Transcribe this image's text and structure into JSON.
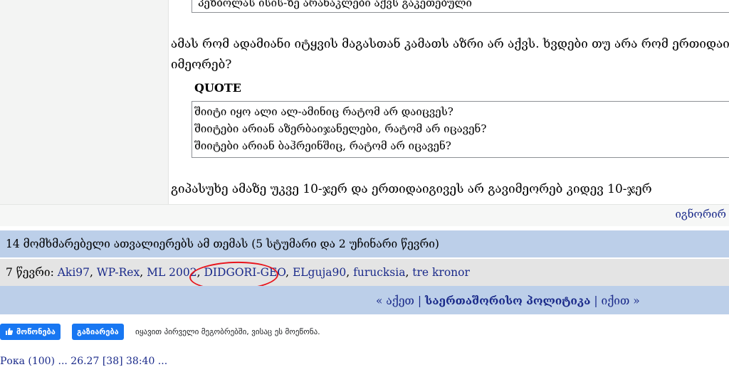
{
  "post": {
    "top_quote_partial": "პეზბოლას ისის-ზე არანაკლები აქვს გაკეთებული",
    "paragraph_1_line_1": "ამას რომ ადამიანი იტყვის მაგასთან კამათს აზრი არ აქვს. ხვდები თუ არა რომ ერთიდაიგივ",
    "paragraph_1_line_2": "იმეორებ?",
    "quote_label": "QUOTE",
    "quote_lines": [
      "შიიტი იყო ალი ალ-ამინიც  რატომ არ დაიცვეს?",
      "შიიტები არიან აზერბაიჯანელები, რატომ არ იცავენ?",
      "შიიტები არიან ბაჰრეინშიც, რატომ არ იცავენ?"
    ],
    "paragraph_2": "გიპასუხე ამაზე უკვე 10-ჯერ და ერთიდაიგივეს არ გავიმეორებ კიდევ 10-ჯერ",
    "ignore_link": "იგნორირ"
  },
  "readers": {
    "summary": "14 მომხმარებელი ათვალიერებს ამ თემას (5 სტუმარი და 2 უჩინარი წევრი)",
    "members_prefix": "7 წევრი: ",
    "members": [
      "Aki97",
      "WP-Rex",
      "ML 2002",
      "DIDGORI-GEO",
      "ELguja90",
      "furucksia",
      "tre kronor"
    ]
  },
  "nav": {
    "prev": "« აქეთ",
    "section": "საერთაშორისო პოლიტიკა",
    "next": "იქით »"
  },
  "social": {
    "like_label": "მოწონება",
    "share_label": "გაზიარება",
    "text": "იყავით პირველი მეგობრებში, ვისაც ეს მოეწონა."
  },
  "bottom_partial": "Рока (100) ... 26.27 [38] 38:40 ..."
}
